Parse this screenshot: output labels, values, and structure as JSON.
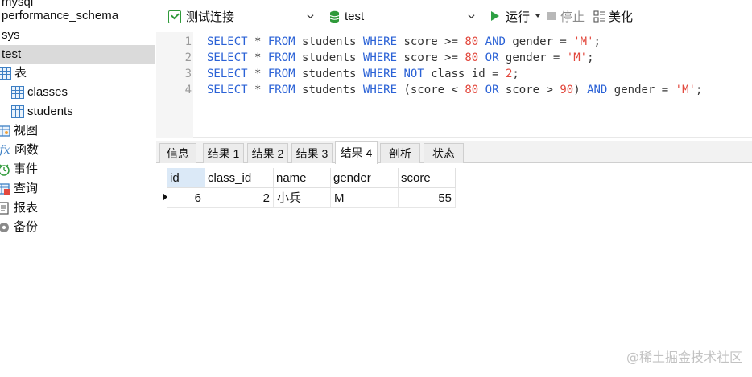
{
  "sidebar": {
    "databases": [
      "mysql",
      "performance_schema",
      "sys",
      "test"
    ],
    "selected_database": "test",
    "tree": [
      {
        "label": "表",
        "icon": "table-group-icon"
      },
      {
        "label": "classes",
        "icon": "table-icon"
      },
      {
        "label": "students",
        "icon": "table-icon"
      },
      {
        "label": "视图",
        "icon": "view-icon"
      },
      {
        "label": "函数",
        "icon": "function-icon"
      },
      {
        "label": "事件",
        "icon": "event-icon"
      },
      {
        "label": "查询",
        "icon": "query-icon"
      },
      {
        "label": "报表",
        "icon": "report-icon"
      },
      {
        "label": "备份",
        "icon": "backup-icon"
      }
    ]
  },
  "toolbar": {
    "connection": "测试连接",
    "database": "test",
    "run_label": "运行",
    "stop_label": "停止",
    "beautify_label": "美化"
  },
  "editor": {
    "line_numbers": [
      "1",
      "2",
      "3",
      "4"
    ],
    "lines": [
      "SELECT * FROM students WHERE score >= 80 AND gender = 'M';",
      "SELECT * FROM students WHERE score >= 80 OR gender = 'M';",
      "SELECT * FROM students WHERE NOT class_id = 2;",
      "SELECT * FROM students WHERE (score < 80 OR score > 90) AND gender = 'M';"
    ]
  },
  "result_tabs": [
    "信息",
    "结果 1",
    "结果 2",
    "结果 3",
    "结果 4",
    "剖析",
    "状态"
  ],
  "active_tab": "结果 4",
  "grid": {
    "columns": [
      "id",
      "class_id",
      "name",
      "gender",
      "score"
    ],
    "rows": [
      [
        "6",
        "2",
        "小兵",
        "M",
        "55"
      ]
    ]
  },
  "watermark": "@稀土掘金技术社区",
  "colors": {
    "keyword": "#2b62d6",
    "literal": "#e2483d",
    "run_green": "#2ea043",
    "selected_row": "#dadada"
  }
}
